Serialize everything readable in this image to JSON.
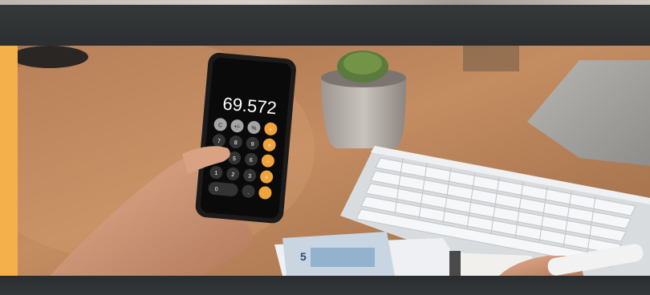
{
  "photo": {
    "calculator_display": "69.572",
    "keypad_rows": [
      [
        "C",
        "+/-",
        "%",
        "÷"
      ],
      [
        "7",
        "8",
        "9",
        "×"
      ],
      [
        "4",
        "5",
        "6",
        "−"
      ],
      [
        "1",
        "2",
        "3",
        "+"
      ],
      [
        "0",
        "",
        ".",
        "="
      ]
    ],
    "banknote_value": "5"
  },
  "colors": {
    "accent": "#f4b04a",
    "frame": "#2d3032",
    "desk": "#b9825a"
  }
}
